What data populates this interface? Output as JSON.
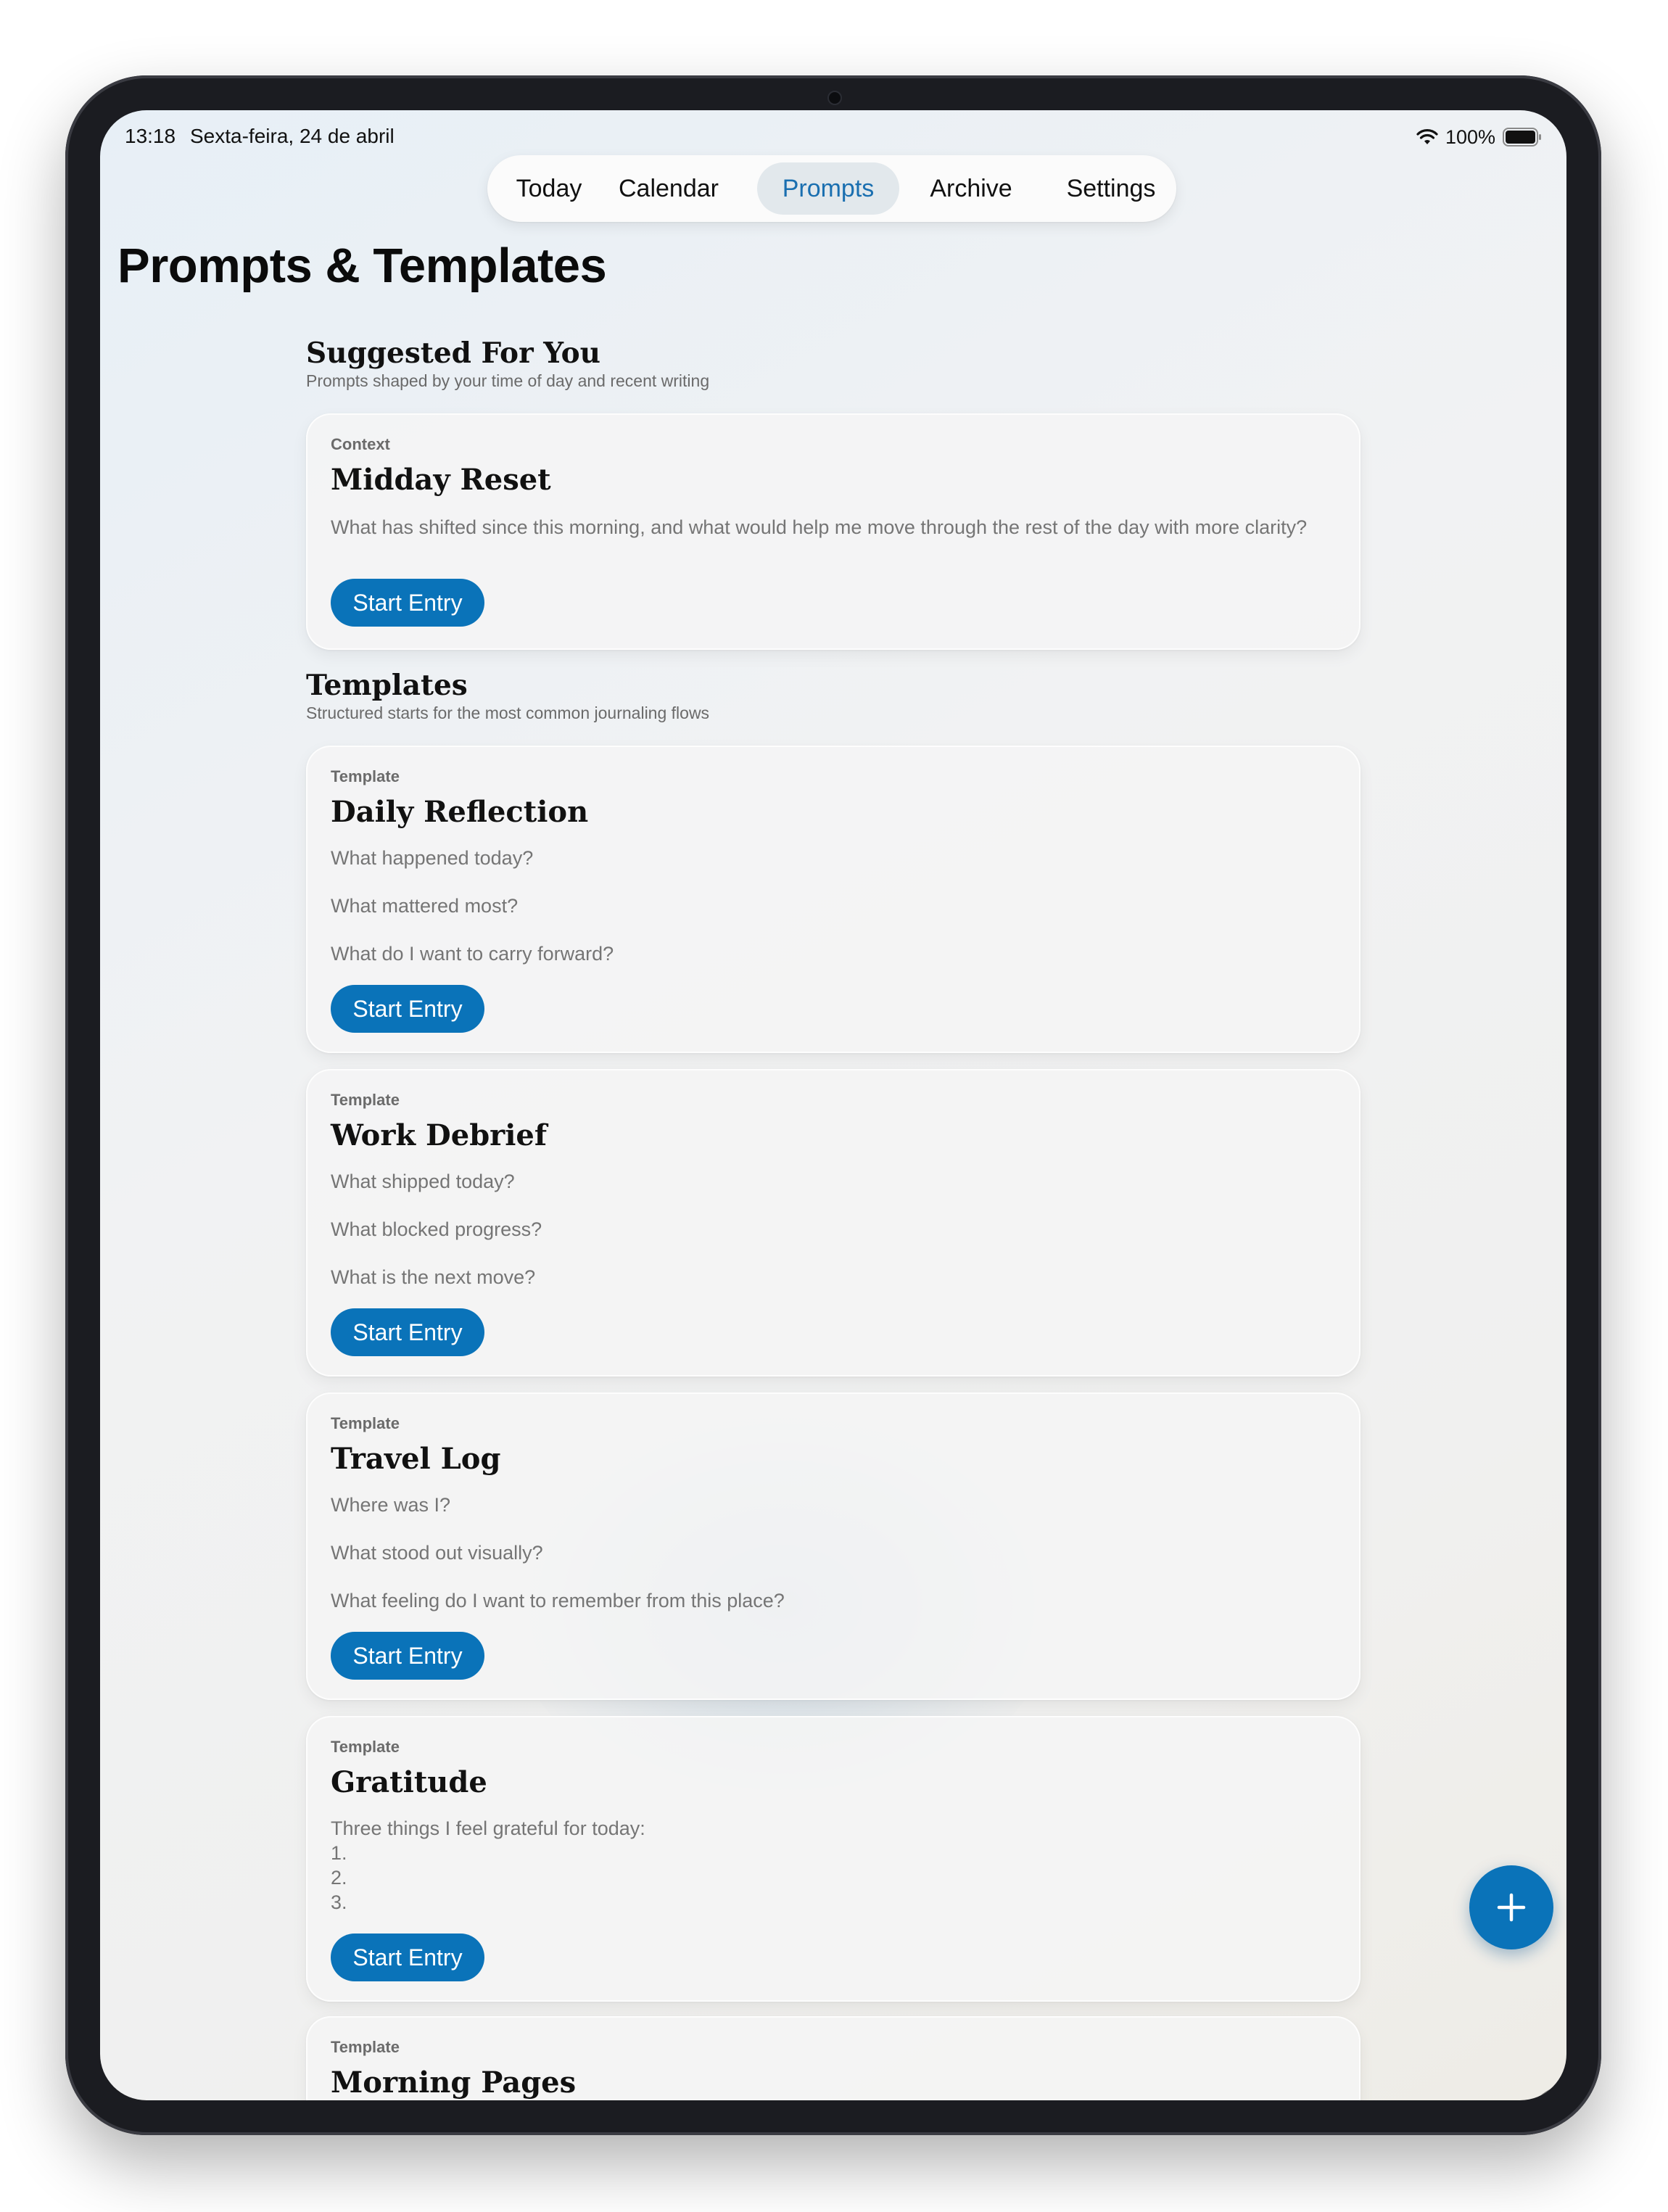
{
  "status": {
    "time": "13:18",
    "date": "Sexta-feira, 24 de abril",
    "battery": "100%"
  },
  "nav": {
    "tabs": [
      {
        "label": "Today",
        "active": false
      },
      {
        "label": "Calendar",
        "active": false
      },
      {
        "label": "Prompts",
        "active": true
      },
      {
        "label": "Archive",
        "active": false
      },
      {
        "label": "Settings",
        "active": false
      }
    ]
  },
  "page": {
    "title": "Prompts & Templates"
  },
  "suggested": {
    "title": "Suggested For You",
    "subtitle": "Prompts shaped by your time of day and recent writing",
    "card": {
      "kicker": "Context",
      "title": "Midday Reset",
      "body": "What has shifted since this morning, and what would help me move through the rest of the day with more clarity?",
      "button": "Start Entry"
    }
  },
  "templates": {
    "title": "Templates",
    "subtitle": "Structured starts for the most common journaling flows",
    "cards": [
      {
        "kicker": "Template",
        "title": "Daily Reflection",
        "lines": [
          "What happened today?",
          "What mattered most?",
          "What do I want to carry forward?"
        ],
        "button": "Start Entry"
      },
      {
        "kicker": "Template",
        "title": "Work Debrief",
        "lines": [
          "What shipped today?",
          "What blocked progress?",
          "What is the next move?"
        ],
        "button": "Start Entry"
      },
      {
        "kicker": "Template",
        "title": "Travel Log",
        "lines": [
          "Where was I?",
          "What stood out visually?",
          "What feeling do I want to remember from this place?"
        ],
        "button": "Start Entry"
      },
      {
        "kicker": "Template",
        "title": "Gratitude",
        "lines": [
          "Three things I feel grateful for today:",
          "1.",
          "2.",
          "3."
        ],
        "button": "Start Entry"
      },
      {
        "kicker": "Template",
        "title": "Morning Pages"
      }
    ]
  },
  "icons": {
    "wifi": "wifi-icon",
    "battery": "battery-icon",
    "fab": "plus-icon"
  },
  "colors": {
    "accent": "#0a73b9",
    "nav_active_bg": "#e2e8ec",
    "nav_active_text": "#1a6fb0"
  }
}
